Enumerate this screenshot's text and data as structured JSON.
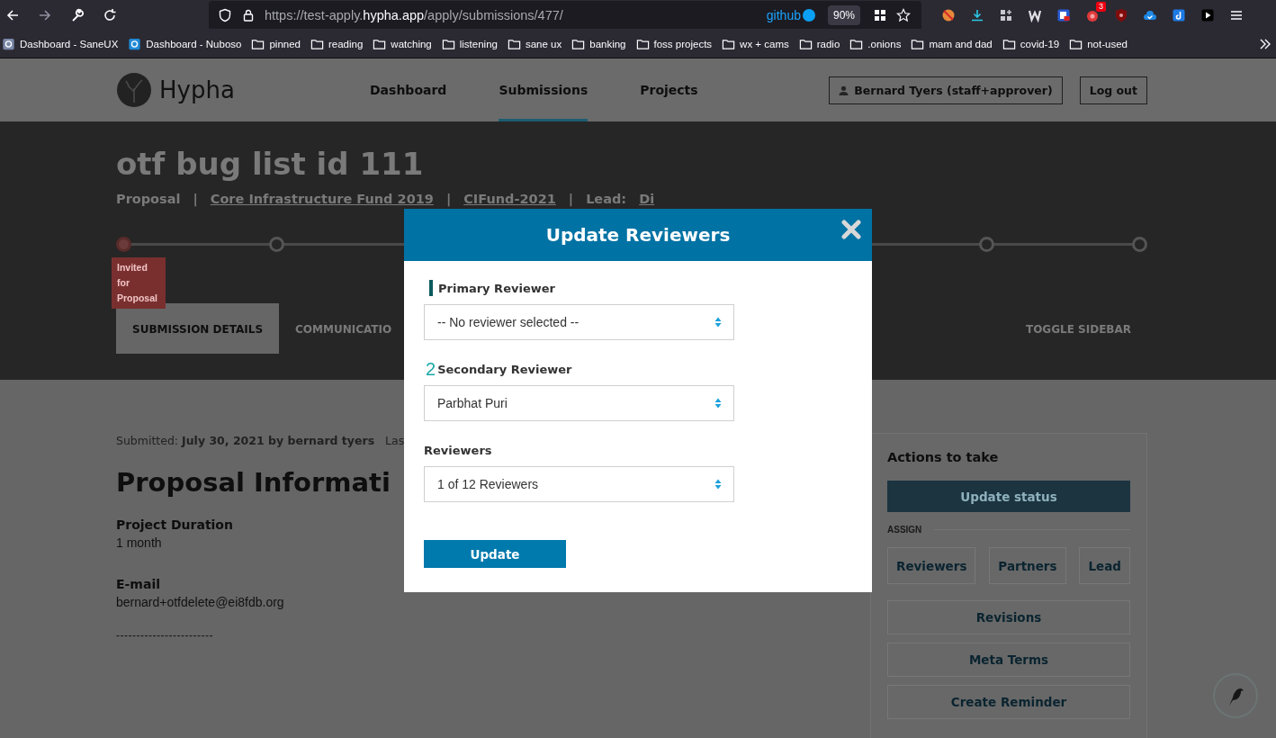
{
  "browser": {
    "url_prefix": "https://test-apply.",
    "url_domain": "hypha.app",
    "url_path": "/apply/submissions/477/",
    "container_label": "github",
    "zoom": "90%",
    "extension_badge": "3",
    "bookmarks": [
      {
        "label": "Dashboard - SaneUX",
        "kind": "site",
        "color": "#7a88a8"
      },
      {
        "label": "Dashboard - Nuboso",
        "kind": "site",
        "color": "#1f8ad6"
      },
      {
        "label": "pinned",
        "kind": "folder"
      },
      {
        "label": "reading",
        "kind": "folder"
      },
      {
        "label": "watching",
        "kind": "folder"
      },
      {
        "label": "listening",
        "kind": "folder"
      },
      {
        "label": "sane ux",
        "kind": "folder"
      },
      {
        "label": "banking",
        "kind": "folder"
      },
      {
        "label": "foss projects",
        "kind": "folder"
      },
      {
        "label": "wx + cams",
        "kind": "folder"
      },
      {
        "label": "radio",
        "kind": "folder"
      },
      {
        "label": ".onions",
        "kind": "folder"
      },
      {
        "label": "mam and dad",
        "kind": "folder"
      },
      {
        "label": "covid-19",
        "kind": "folder"
      },
      {
        "label": "not-used",
        "kind": "folder"
      }
    ]
  },
  "site": {
    "brand": "Hypha",
    "nav": [
      {
        "label": "Dashboard",
        "selected": false
      },
      {
        "label": "Submissions",
        "selected": true
      },
      {
        "label": "Projects",
        "selected": false
      }
    ],
    "user_button": "Bernard Tyers (staff+approver)",
    "logout_button": "Log out"
  },
  "submission": {
    "title": "otf bug list id 111",
    "meta": [
      {
        "text": "Proposal",
        "link": false
      },
      {
        "text": "Core Infrastructure Fund 2019",
        "link": true
      },
      {
        "text": "CIFund-2021",
        "link": true
      }
    ],
    "separator": "|",
    "lead_label": "Lead:",
    "lead": "Di",
    "steps_left": [
      {
        "label": "Invited for Proposal",
        "selected": true
      },
      {
        "selected": false
      }
    ],
    "steps_right": [
      {
        "selected": false
      },
      {
        "selected": false
      }
    ],
    "tabs": [
      {
        "label": "SUBMISSION DETAILS",
        "selected": true
      },
      {
        "label": "COMMUNICATIO",
        "selected": false
      }
    ],
    "toggle_sidebar": "TOGGLE SIDEBAR"
  },
  "details": {
    "submitted": "Submitted: **July 30, 2021 by bernard tyers**",
    "last": "Las",
    "heading": "Proposal Informati",
    "fields": [
      {
        "label": "Project Duration",
        "value": "1 month"
      },
      {
        "label": "E-mail",
        "value": "bernard+otfdelete@ei8fdb.org"
      }
    ],
    "separator": "------------------------"
  },
  "actions": {
    "title": "Actions to take",
    "primary": "Update status",
    "assign_label": "ASSIGN",
    "assign_buttons": [
      "Reviewers",
      "Partners",
      "Lead"
    ],
    "buttons": [
      "Revisions",
      "Meta Terms",
      "Create Reminder"
    ]
  },
  "modal": {
    "title": "Update Reviewers",
    "fields": [
      {
        "label": "Primary Reviewer",
        "kind": "bar",
        "value": "-- No reviewer selected --"
      },
      {
        "label": "Secondary Reviewer",
        "kind": "digit",
        "marker": "2",
        "value": "Parbhat Puri"
      },
      {
        "label": "Reviewers",
        "kind": "plain",
        "value": "1 of 12 Reviewers"
      }
    ],
    "submit": "Update"
  }
}
